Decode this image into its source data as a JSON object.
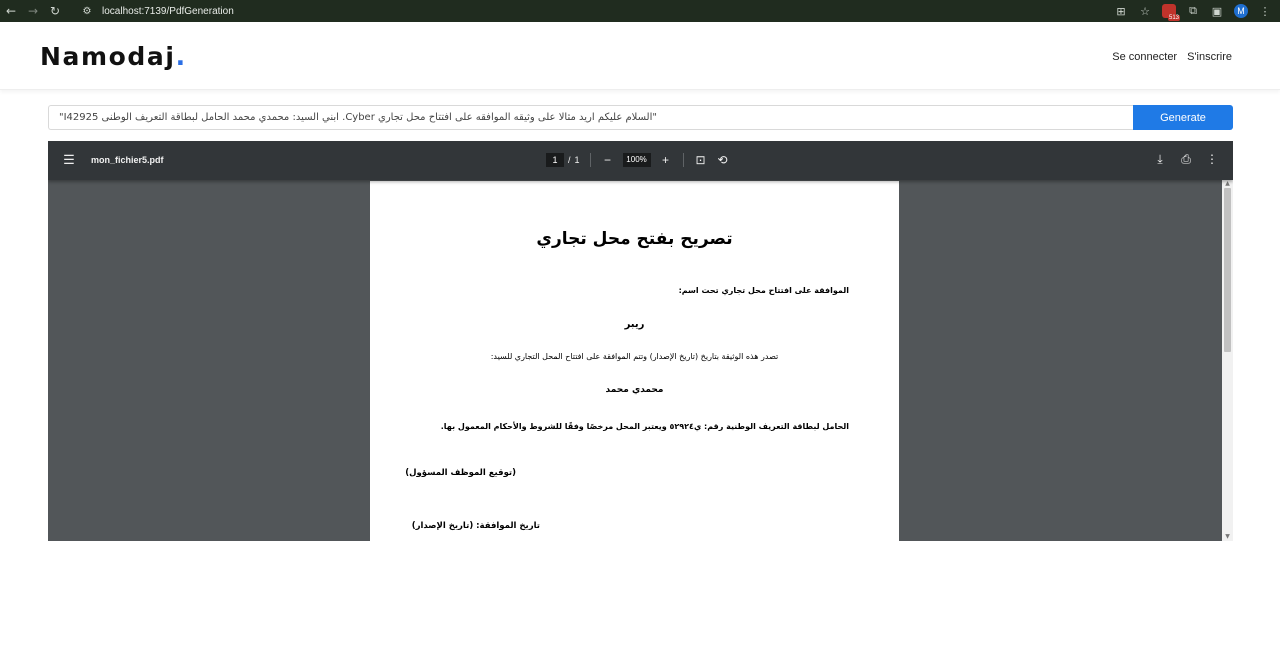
{
  "browser": {
    "url": "localhost:7139/PdfGeneration",
    "extension_badge": "513",
    "profile_initial": "M"
  },
  "site": {
    "logo_text": "Namodaj",
    "logo_dot": ".",
    "nav": {
      "login": "Se connecter",
      "signup": "S'inscrire"
    }
  },
  "prompt": {
    "value": "\"السلام عليكم اريد مثالا على وثيقه الموافقه على افتتاح محل تجاري Cyber. ابني السيد: محمدي محمد الحامل لبطاقة التعريف الوطنى I42925\"",
    "button_label": "Generate"
  },
  "viewer": {
    "filename": "mon_fichier5.pdf",
    "current_page": "1",
    "page_separator": "/",
    "total_pages": "1",
    "zoom": "100%"
  },
  "document": {
    "title": "تصريح بفتح محل تجاري",
    "line1": "الموافقة على افتتاح محل تجاري تحت اسم:",
    "shop_name": "ريبر",
    "line3": "تصدر هذه الوثيقة بتاريخ (تاريخ الإصدار) وتتم الموافقة على افتتاح المحل التجاري للسيد:",
    "person_name": "محمدي محمد",
    "line5": "الحامل لبطاقة التعريف الوطنية رقم: ي٥٢٩٢٤ ويعتبر المحل مرخصًا وفقًا للشروط والأحكام المعمول بها.",
    "signature": "(توقيع الموظف المسؤول)",
    "approval_date": "تاريخ الموافقة: (تاريخ الإصدار)"
  }
}
